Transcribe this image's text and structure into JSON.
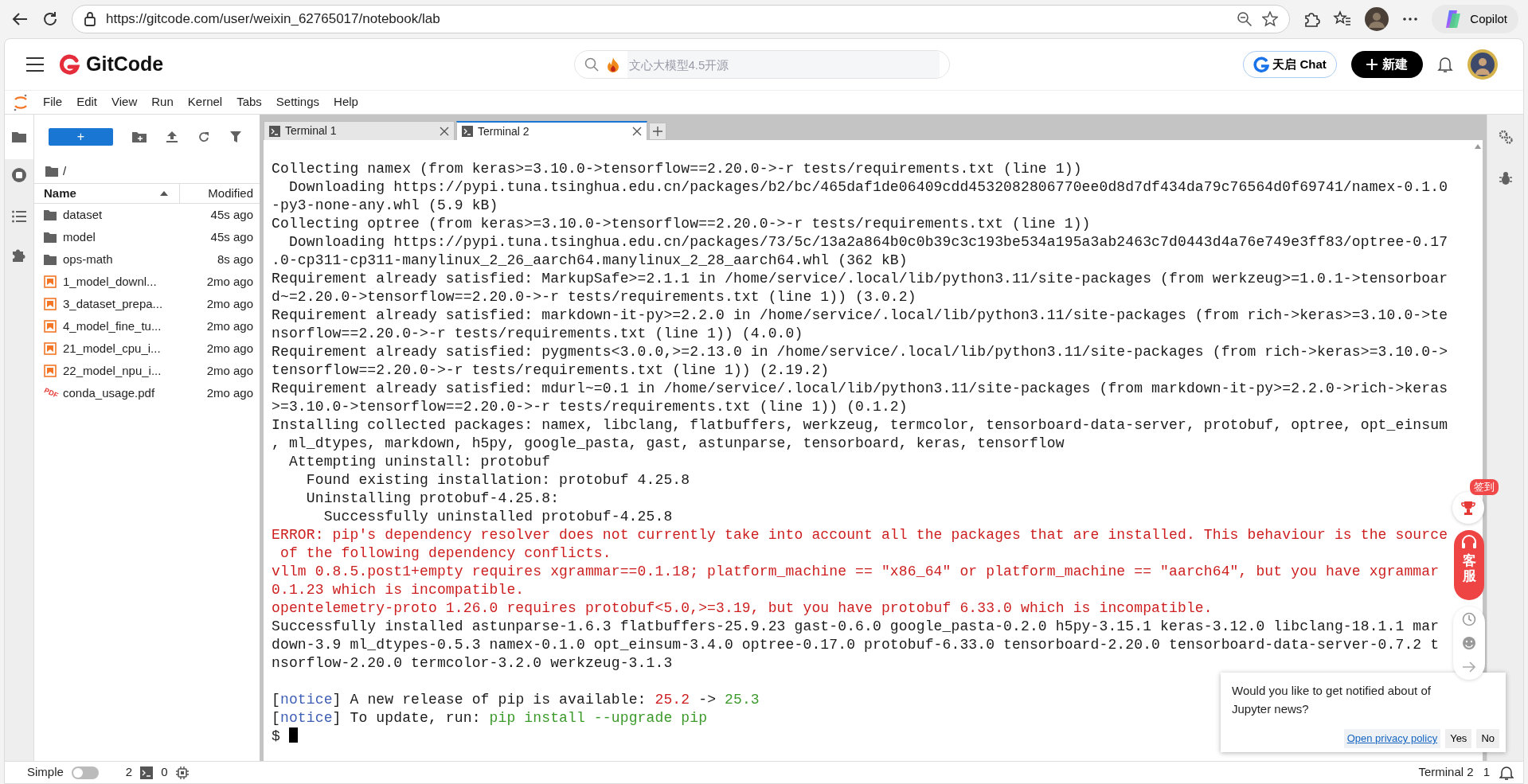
{
  "browser": {
    "url": "https://gitcode.com/user/weixin_62765017/notebook/lab",
    "copilot_label": "Copilot"
  },
  "header": {
    "brand": "GitCode",
    "search": {
      "placeholder": "文心大模型4.5开源"
    },
    "chat_button": "天启 Chat",
    "new_button": "新建"
  },
  "menu": [
    "File",
    "Edit",
    "View",
    "Run",
    "Kernel",
    "Tabs",
    "Settings",
    "Help"
  ],
  "file_browser": {
    "new_button": "+",
    "path": "/",
    "columns": [
      {
        "label": "Name",
        "sorted": true
      },
      {
        "label": "Modified",
        "sorted": false
      }
    ],
    "items": [
      {
        "name": "dataset",
        "modified": "45s ago",
        "kind": "folder"
      },
      {
        "name": "model",
        "modified": "45s ago",
        "kind": "folder"
      },
      {
        "name": "ops-math",
        "modified": "8s ago",
        "kind": "folder"
      },
      {
        "name": "1_model_downl...",
        "modified": "2mo ago",
        "kind": "notebook"
      },
      {
        "name": "3_dataset_prepa...",
        "modified": "2mo ago",
        "kind": "notebook"
      },
      {
        "name": "4_model_fine_tu...",
        "modified": "2mo ago",
        "kind": "notebook"
      },
      {
        "name": "21_model_cpu_i...",
        "modified": "2mo ago",
        "kind": "notebook"
      },
      {
        "name": "22_model_npu_i...",
        "modified": "2mo ago",
        "kind": "notebook"
      },
      {
        "name": "conda_usage.pdf",
        "modified": "2mo ago",
        "kind": "pdf",
        "icon_label": "PDF"
      }
    ]
  },
  "tabs": [
    {
      "label": "Terminal 1",
      "selected": false
    },
    {
      "label": "Terminal 2",
      "selected": true
    }
  ],
  "terminal": {
    "blocks": [
      [
        [
          {
            "text": "Collecting namex (from keras>=3.10.0->tensorflow==2.20.0->-r tests/requirements.txt (line 1))",
            "color": "#1a1a1a"
          }
        ],
        [
          {
            "text": "  Downloading https://pypi.tuna.tsinghua.edu.cn/packages/b2/bc/465daf1de06409cdd4532082806770ee0d8d7df434da79c76564d0f69741/namex-0.1.0",
            "color": "#1a1a1a"
          }
        ],
        [
          {
            "text": "-py3-none-any.whl (5.9 kB)",
            "color": "#1a1a1a"
          }
        ],
        [
          {
            "text": "Collecting optree (from keras>=3.10.0->tensorflow==2.20.0->-r tests/requirements.txt (line 1))",
            "color": "#1a1a1a"
          }
        ],
        [
          {
            "text": "  Downloading https://pypi.tuna.tsinghua.edu.cn/packages/73/5c/13a2a864b0c0b39c3c193be534a195a3ab2463c7d0443d4a76e749e3ff83/optree-0.17",
            "color": "#1a1a1a"
          }
        ],
        [
          {
            "text": ".0-cp311-cp311-manylinux_2_26_aarch64.manylinux_2_28_aarch64.whl (362 kB)",
            "color": "#1a1a1a"
          }
        ],
        [
          {
            "text": "Requirement already satisfied: MarkupSafe>=2.1.1 in /home/service/.local/lib/python3.11/site-packages (from werkzeug>=1.0.1->tensorboar",
            "color": "#1a1a1a"
          }
        ],
        [
          {
            "text": "d~=2.20.0->tensorflow==2.20.0->-r tests/requirements.txt (line 1)) (3.0.2)",
            "color": "#1a1a1a"
          }
        ],
        [
          {
            "text": "Requirement already satisfied: markdown-it-py>=2.2.0 in /home/service/.local/lib/python3.11/site-packages (from rich->keras>=3.10.0->te",
            "color": "#1a1a1a"
          }
        ],
        [
          {
            "text": "nsorflow==2.20.0->-r tests/requirements.txt (line 1)) (4.0.0)",
            "color": "#1a1a1a"
          }
        ],
        [
          {
            "text": "Requirement already satisfied: pygments<3.0.0,>=2.13.0 in /home/service/.local/lib/python3.11/site-packages (from rich->keras>=3.10.0->",
            "color": "#1a1a1a"
          }
        ],
        [
          {
            "text": "tensorflow==2.20.0->-r tests/requirements.txt (line 1)) (2.19.2)",
            "color": "#1a1a1a"
          }
        ],
        [
          {
            "text": "Requirement already satisfied: mdurl~=0.1 in /home/service/.local/lib/python3.11/site-packages (from markdown-it-py>=2.2.0->rich->keras",
            "color": "#1a1a1a"
          }
        ],
        [
          {
            "text": ">=3.10.0->tensorflow==2.20.0->-r tests/requirements.txt (line 1)) (0.1.2)",
            "color": "#1a1a1a"
          }
        ],
        [
          {
            "text": "Installing collected packages: namex, libclang, flatbuffers, werkzeug, termcolor, tensorboard-data-server, protobuf, optree, opt_einsum",
            "color": "#1a1a1a"
          }
        ],
        [
          {
            "text": ", ml_dtypes, markdown, h5py, google_pasta, gast, astunparse, tensorboard, keras, tensorflow",
            "color": "#1a1a1a"
          }
        ],
        [
          {
            "text": "  Attempting uninstall: protobuf",
            "color": "#1a1a1a"
          }
        ],
        [
          {
            "text": "    Found existing installation: protobuf 4.25.8",
            "color": "#1a1a1a"
          }
        ],
        [
          {
            "text": "    Uninstalling protobuf-4.25.8:",
            "color": "#1a1a1a"
          }
        ],
        [
          {
            "text": "      Successfully uninstalled protobuf-4.25.8",
            "color": "#1a1a1a"
          }
        ],
        [
          {
            "text": "ERROR: pip's dependency resolver does not currently take into account all the packages that are installed. This behaviour is the source",
            "color": "#cd1f1f"
          }
        ],
        [
          {
            "text": " of the following dependency conflicts.",
            "color": "#cd1f1f"
          }
        ],
        [
          {
            "text": "vllm 0.8.5.post1+empty requires xgrammar==0.1.18; platform_machine == \"x86_64\" or platform_machine == \"aarch64\", but you have xgrammar",
            "color": "#cd1f1f"
          }
        ],
        [
          {
            "text": "0.1.23 which is incompatible.",
            "color": "#cd1f1f"
          }
        ],
        [
          {
            "text": "opentelemetry-proto 1.26.0 requires protobuf<5.0,>=3.19, but you have protobuf 6.33.0 which is incompatible.",
            "color": "#cd1f1f"
          }
        ],
        [
          {
            "text": "Successfully installed astunparse-1.6.3 flatbuffers-25.9.23 gast-0.6.0 google_pasta-0.2.0 h5py-3.15.1 keras-3.12.0 libclang-18.1.1 mar",
            "color": "#1a1a1a"
          }
        ],
        [
          {
            "text": "down-3.9 ml_dtypes-0.5.3 namex-0.1.0 opt_einsum-3.4.0 optree-0.17.0 protobuf-6.33.0 tensorboard-2.20.0 tensorboard-data-server-0.7.2 t",
            "color": "#1a1a1a"
          }
        ],
        [
          {
            "text": "nsorflow-2.20.0 termcolor-3.2.0 werkzeug-3.1.3",
            "color": "#1a1a1a"
          }
        ]
      ],
      [
        [
          {
            "text": "[",
            "color": "#1a1a1a"
          },
          {
            "text": "notice",
            "color": "#3f5fb5"
          },
          {
            "text": "] A new release of pip is available: ",
            "color": "#1a1a1a"
          },
          {
            "text": "25.2",
            "color": "#cd1f1f"
          },
          {
            "text": " -> ",
            "color": "#1a1a1a"
          },
          {
            "text": "25.3",
            "color": "#3c9a2b"
          }
        ],
        [
          {
            "text": "[",
            "color": "#1a1a1a"
          },
          {
            "text": "notice",
            "color": "#3f5fb5"
          },
          {
            "text": "] To update, run: ",
            "color": "#1a1a1a"
          },
          {
            "text": "pip install --upgrade pip",
            "color": "#3c9a2b"
          }
        ]
      ]
    ],
    "prompt": "$"
  },
  "status_bar": {
    "mode_label": "Simple",
    "simple_mode": false,
    "terminal_count": "2",
    "kernel_count": "0",
    "active_tab": "Terminal 2",
    "notification_count": "1"
  },
  "notification": {
    "message_lines": [
      "Would you like to get notified about of",
      "Jupyter news?"
    ],
    "link": "Open privacy policy",
    "buttons": [
      "Yes",
      "No"
    ]
  },
  "floating": {
    "badge": "签到",
    "service_label": "客服"
  }
}
